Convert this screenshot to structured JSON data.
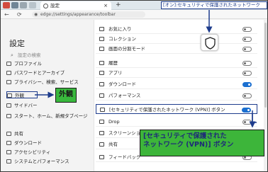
{
  "browser": {
    "tab_title": "設定",
    "tab_close": "×",
    "new_tab": "+",
    "url": "edge://settings/appearance/toolbar",
    "nav": {
      "back": "←",
      "refresh": "⟳"
    }
  },
  "sidebar": {
    "title": "設定",
    "search_placeholder": "設定の検索",
    "items": [
      {
        "label": "プロファイル"
      },
      {
        "label": "パスワードとアーカイブ"
      },
      {
        "label": "プライバシー、検索、サービス"
      },
      {
        "label": "外観"
      },
      {
        "label": "サイドバー"
      },
      {
        "label": "スタート、ホーム、新規タブページ"
      },
      {
        "label": "共有"
      },
      {
        "label": "ダウンロード"
      },
      {
        "label": "アクセシビリティ"
      },
      {
        "label": "システムとパフォーマンス"
      }
    ]
  },
  "settings_rows": [
    {
      "label": "お気に入り",
      "toggle": "off"
    },
    {
      "label": "コレクション",
      "toggle": "off"
    },
    {
      "label": "画面の分割モード",
      "toggle": "off"
    },
    {
      "label": "履歴",
      "toggle": "off"
    },
    {
      "label": "アプリ",
      "toggle": "off"
    },
    {
      "label": "ダウンロード",
      "toggle": "on"
    },
    {
      "label": "パフォーマンス",
      "toggle": "off"
    },
    {
      "label": "[セキュリティで保護されたネットワーク (VPN)] ボタン",
      "toggle": "on"
    },
    {
      "label": "Drop",
      "toggle": "off"
    },
    {
      "label": "スクリーンショット",
      "toggle": "off"
    },
    {
      "label": "共有",
      "toggle": "off"
    },
    {
      "label": "フィードバック",
      "toggle": "off"
    }
  ],
  "annotations": {
    "top_callout": "[オン]:セキュリティで保護されたネットワーク",
    "left_callout": "外観",
    "bottom_callout_line1": "[セキュリティで保護された",
    "bottom_callout_line2": "ネットワーク (VPN)] ボタン"
  },
  "colors": {
    "callout_green": "#3db53a",
    "callout_border_blue": "#1e3c8c",
    "toggle_on": "#1b6fd0"
  }
}
